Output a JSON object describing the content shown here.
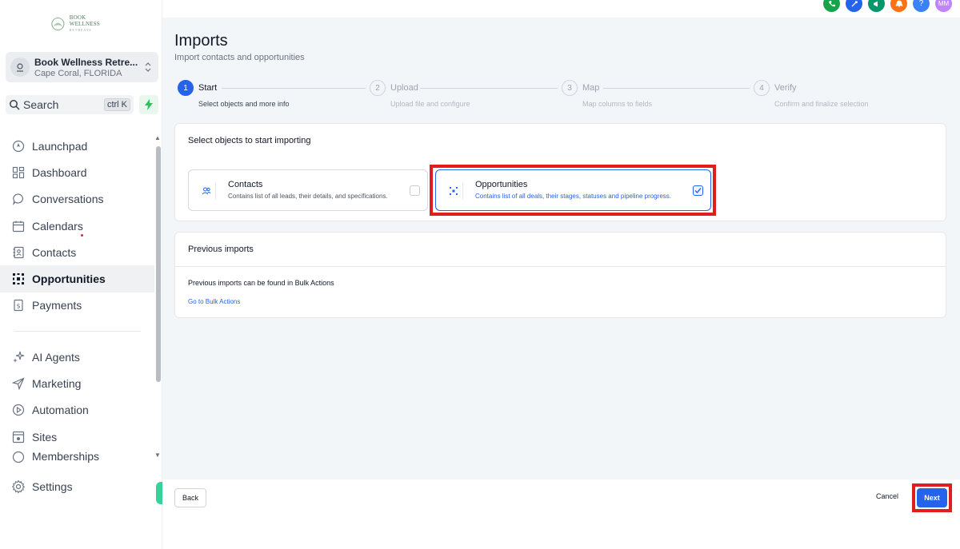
{
  "sidebar": {
    "logo_text": "BOOK WELLNESS",
    "logo_subtext": "RETREATS",
    "location_name": "Book Wellness Retre...",
    "location_city": "Cape Coral, FLORIDA",
    "search_label": "Search",
    "search_shortcut": "ctrl K",
    "items": [
      {
        "label": "Launchpad",
        "icon": "rocket-icon"
      },
      {
        "label": "Dashboard",
        "icon": "grid-icon"
      },
      {
        "label": "Conversations",
        "icon": "chat-icon"
      },
      {
        "label": "Calendars",
        "icon": "calendar-icon"
      },
      {
        "label": "Contacts",
        "icon": "contacts-icon"
      },
      {
        "label": "Opportunities",
        "icon": "opportunities-icon"
      },
      {
        "label": "Payments",
        "icon": "payments-icon"
      }
    ],
    "items2": [
      {
        "label": "AI Agents",
        "icon": "sparkle-icon"
      },
      {
        "label": "Marketing",
        "icon": "send-icon"
      },
      {
        "label": "Automation",
        "icon": "automation-icon"
      },
      {
        "label": "Sites",
        "icon": "sites-icon"
      },
      {
        "label": "Memberships",
        "icon": "memberships-icon"
      }
    ],
    "settings_label": "Settings",
    "active": "Opportunities"
  },
  "topbar": {
    "icons": [
      {
        "name": "phone-icon",
        "color": "#16a34a"
      },
      {
        "name": "settings-gear-icon",
        "color": "#2563eb"
      },
      {
        "name": "megaphone-icon",
        "color": "#059669"
      },
      {
        "name": "bell-icon",
        "color": "#f97316"
      },
      {
        "name": "help-icon",
        "color": "#3b82f6"
      },
      {
        "name": "avatar-icon",
        "color": "#c084fc"
      }
    ],
    "help_glyph": "?",
    "avatar_initials": "MM"
  },
  "page": {
    "title": "Imports",
    "subtitle": "Import contacts and opportunities"
  },
  "steps": [
    {
      "num": "1",
      "title": "Start",
      "desc": "Select objects and more info",
      "active": true
    },
    {
      "num": "2",
      "title": "Upload",
      "desc": "Upload file and configure",
      "active": false
    },
    {
      "num": "3",
      "title": "Map",
      "desc": "Map columns to fields",
      "active": false
    },
    {
      "num": "4",
      "title": "Verify",
      "desc": "Confirm and finalize selection",
      "active": false
    }
  ],
  "select_card": {
    "heading": "Select objects to start importing",
    "options": [
      {
        "title": "Contacts",
        "desc": "Contains list of all leads, their details, and specifications.",
        "checked": false
      },
      {
        "title": "Opportunities",
        "desc": "Contains list of all deals, their stages, statuses and pipeline progress.",
        "checked": true
      }
    ]
  },
  "previous_card": {
    "heading": "Previous imports",
    "message": "Previous imports can be found in Bulk Actions",
    "link": "Go to Bulk Actions"
  },
  "footer": {
    "back": "Back",
    "cancel": "Cancel",
    "next": "Next"
  },
  "colors": {
    "accent": "#2563eb",
    "highlight": "#e11d1d"
  }
}
